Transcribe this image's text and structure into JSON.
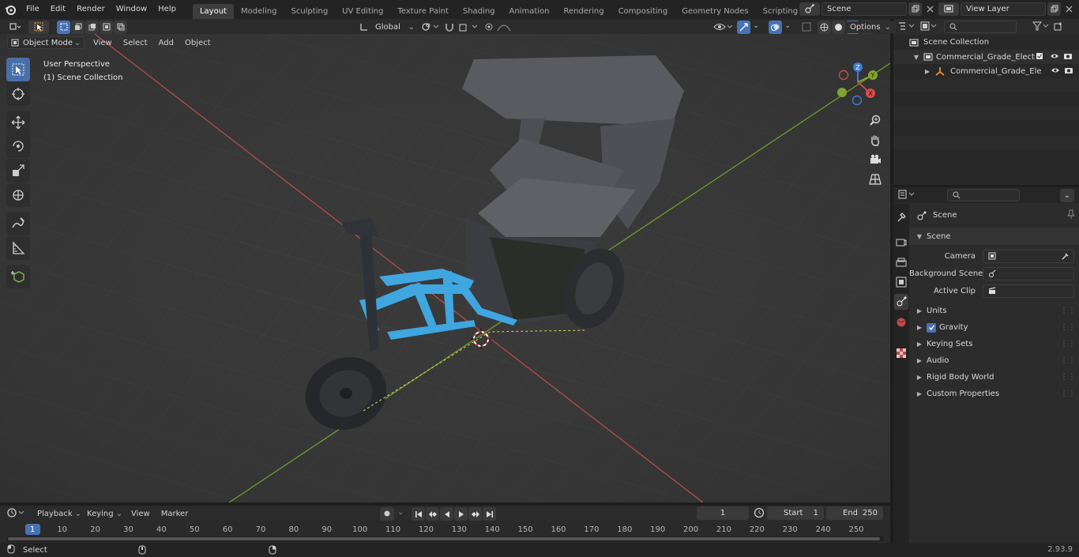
{
  "menu": [
    "File",
    "Edit",
    "Render",
    "Window",
    "Help"
  ],
  "workspaces": [
    {
      "label": "Layout",
      "active": true
    },
    {
      "label": "Modeling"
    },
    {
      "label": "Sculpting"
    },
    {
      "label": "UV Editing"
    },
    {
      "label": "Texture Paint"
    },
    {
      "label": "Shading"
    },
    {
      "label": "Animation"
    },
    {
      "label": "Rendering"
    },
    {
      "label": "Compositing"
    },
    {
      "label": "Geometry Nodes"
    },
    {
      "label": "Scripting"
    }
  ],
  "add_tab_symbol": "+",
  "scene_field": "Scene",
  "view_layer_field": "View Layer",
  "viewport_header": {
    "mode": "Object Mode",
    "menus": [
      "View",
      "Select",
      "Add",
      "Object"
    ],
    "transform_orientation": "Global",
    "options": "Options"
  },
  "overlay_text": {
    "perspective": "User Perspective",
    "collection": "(1) Scene Collection"
  },
  "gizmo": {
    "z": "Z",
    "y": "Y",
    "x": "X"
  },
  "outliner": {
    "root": "Scene Collection",
    "items": [
      {
        "label": "Commercial_Grade_Electric_T",
        "level": 1
      },
      {
        "label": "Commercial_Grade_Elect",
        "level": 2
      }
    ]
  },
  "properties": {
    "context": "Scene",
    "section": "Scene",
    "fields": [
      {
        "label": "Camera"
      },
      {
        "label": "Background Scene"
      },
      {
        "label": "Active Clip"
      }
    ],
    "subpanels": [
      "Units",
      "Gravity",
      "Keying Sets",
      "Audio",
      "Rigid Body World",
      "Custom Properties"
    ]
  },
  "timeline": {
    "menus": [
      "Playback",
      "Keying",
      "View",
      "Marker"
    ],
    "current_frame": "1",
    "start_label": "Start",
    "start": "1",
    "end_label": "End",
    "end": "250",
    "ticks": [
      "1",
      "10",
      "20",
      "30",
      "40",
      "50",
      "60",
      "70",
      "80",
      "90",
      "100",
      "110",
      "120",
      "130",
      "140",
      "150",
      "160",
      "170",
      "180",
      "190",
      "200",
      "210",
      "220",
      "230",
      "240",
      "250"
    ]
  },
  "status": {
    "left": "Select",
    "version": "2.93.9"
  },
  "colors": {
    "accent": "#4772b3",
    "x_axis": "#c44c4c",
    "y_axis": "#7fa42e",
    "frame_blue": "#3fa6e0"
  }
}
